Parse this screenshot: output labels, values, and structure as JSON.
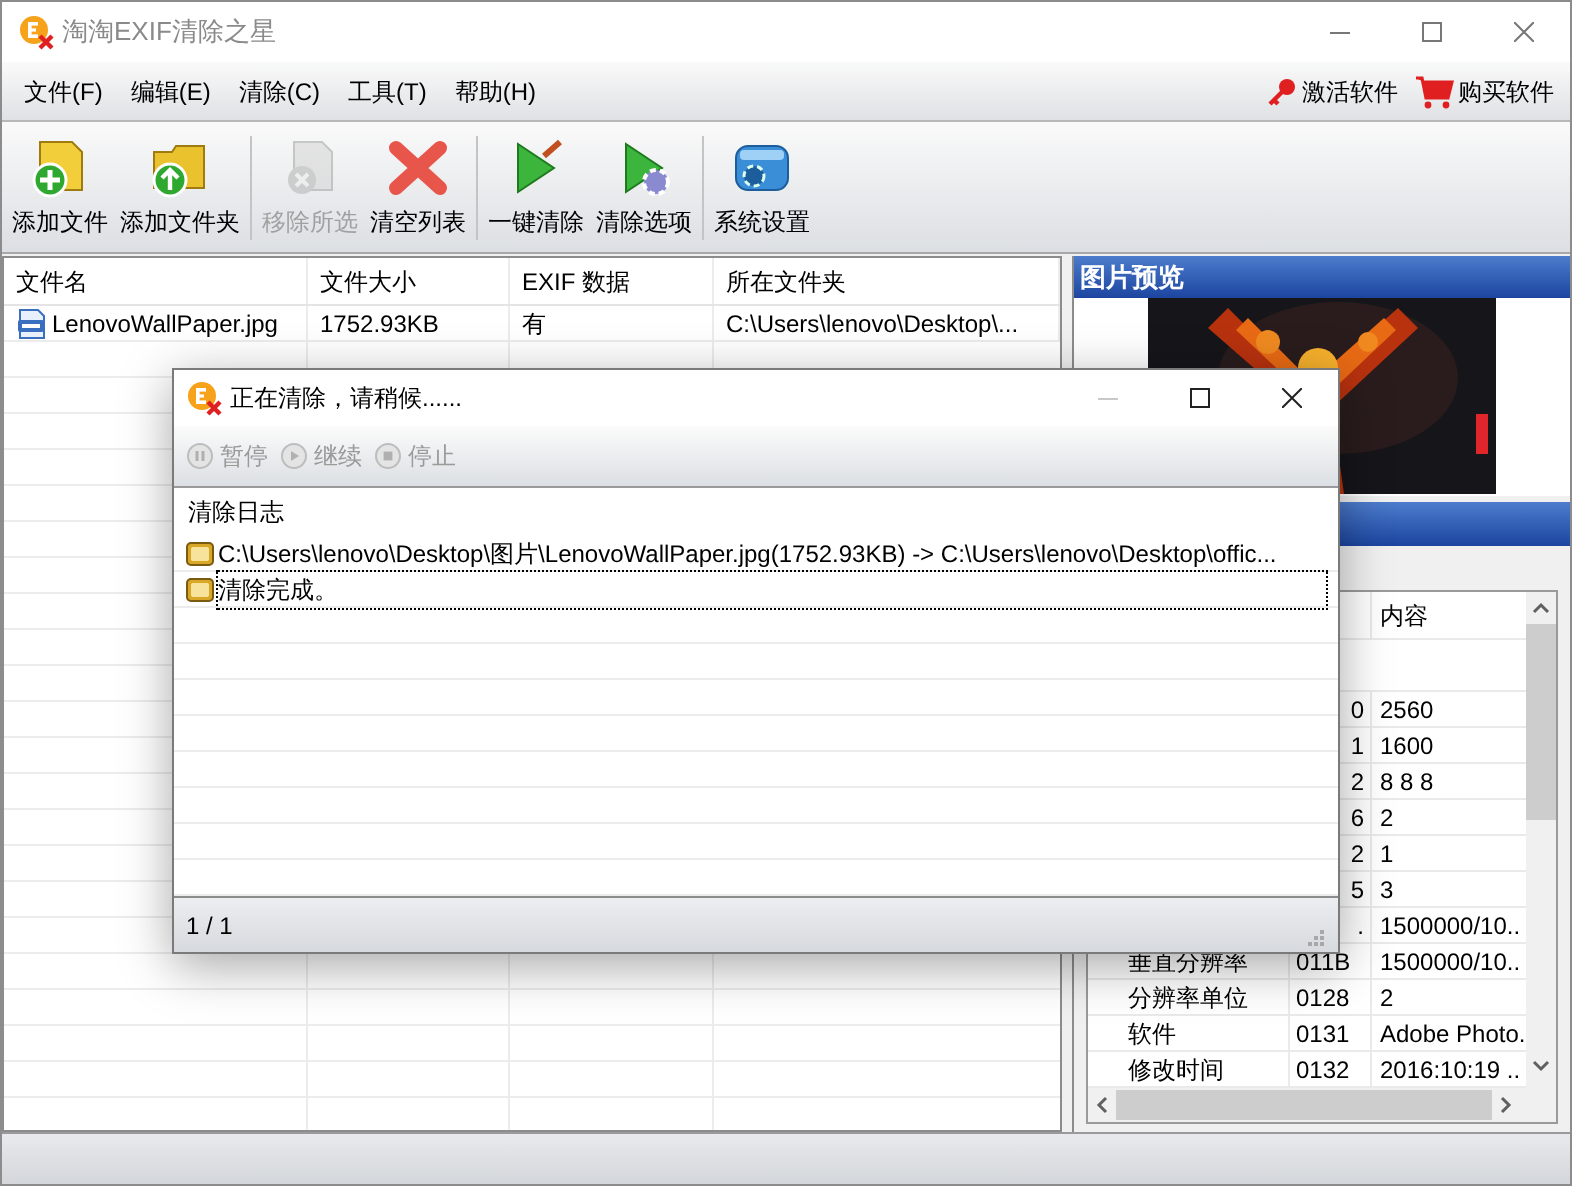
{
  "window": {
    "title": "淘淘EXIF清除之星"
  },
  "menu": [
    "文件(F)",
    "编辑(E)",
    "清除(C)",
    "工具(T)",
    "帮助(H)"
  ],
  "menu_actions": [
    {
      "label": "激活软件",
      "kind": "key"
    },
    {
      "label": "购买软件",
      "kind": "cart"
    }
  ],
  "toolbar": {
    "groups": [
      [
        {
          "label": "添加文件",
          "kind": "add-file",
          "disabled": false
        },
        {
          "label": "添加文件夹",
          "kind": "add-folder",
          "disabled": false
        }
      ],
      [
        {
          "label": "移除所选",
          "kind": "remove",
          "disabled": true
        },
        {
          "label": "清空列表",
          "kind": "clear",
          "disabled": false
        }
      ],
      [
        {
          "label": "一键清除",
          "kind": "clean",
          "disabled": false
        },
        {
          "label": "清除选项",
          "kind": "clean-options",
          "disabled": false
        }
      ],
      [
        {
          "label": "系统设置",
          "kind": "settings",
          "disabled": false
        }
      ]
    ]
  },
  "file_list": {
    "columns": [
      "文件名",
      "文件大小",
      "EXIF 数据",
      "所在文件夹"
    ],
    "rows": [
      {
        "cells": [
          "LenovoWallPaper.jpg",
          "1752.93KB",
          "有",
          "C:\\Users\\lenovo\\Desktop\\..."
        ]
      }
    ]
  },
  "preview": {
    "title": "图片预览"
  },
  "exif_table": {
    "columns": [
      "内容"
    ],
    "rows": [
      {
        "tag": "0",
        "value": "2560"
      },
      {
        "tag": "1",
        "value": "1600"
      },
      {
        "tag": "2",
        "value": "8 8 8"
      },
      {
        "tag": "6",
        "value": "2"
      },
      {
        "tag": "2",
        "value": "1"
      },
      {
        "tag": "5",
        "value": "3"
      },
      {
        "tag": ".",
        "value": "1500000/10.."
      },
      {
        "name": "垂直分辨率",
        "tag": "011B",
        "value": "1500000/10.."
      },
      {
        "name": "分辨率单位",
        "tag": "0128",
        "value": "2"
      },
      {
        "name": "软件",
        "tag": "0131",
        "value": "Adobe Photo."
      },
      {
        "name": "修改时间",
        "tag": "0132",
        "value": "2016:10:19 .."
      }
    ]
  },
  "dialog": {
    "title": "正在清除，请稍候......",
    "controls": [
      {
        "label": "暂停",
        "kind": "pause",
        "disabled": true
      },
      {
        "label": "继续",
        "kind": "play",
        "disabled": true
      },
      {
        "label": "停止",
        "kind": "stop",
        "disabled": true
      }
    ],
    "log": {
      "title": "清除日志",
      "entries": [
        {
          "text": "C:\\Users\\lenovo\\Desktop\\图片\\LenovoWallPaper.jpg(1752.93KB) -> C:\\Users\\lenovo\\Desktop\\offic...",
          "focused": false
        },
        {
          "text": "清除完成。",
          "focused": true
        }
      ]
    },
    "status": "1 / 1"
  }
}
